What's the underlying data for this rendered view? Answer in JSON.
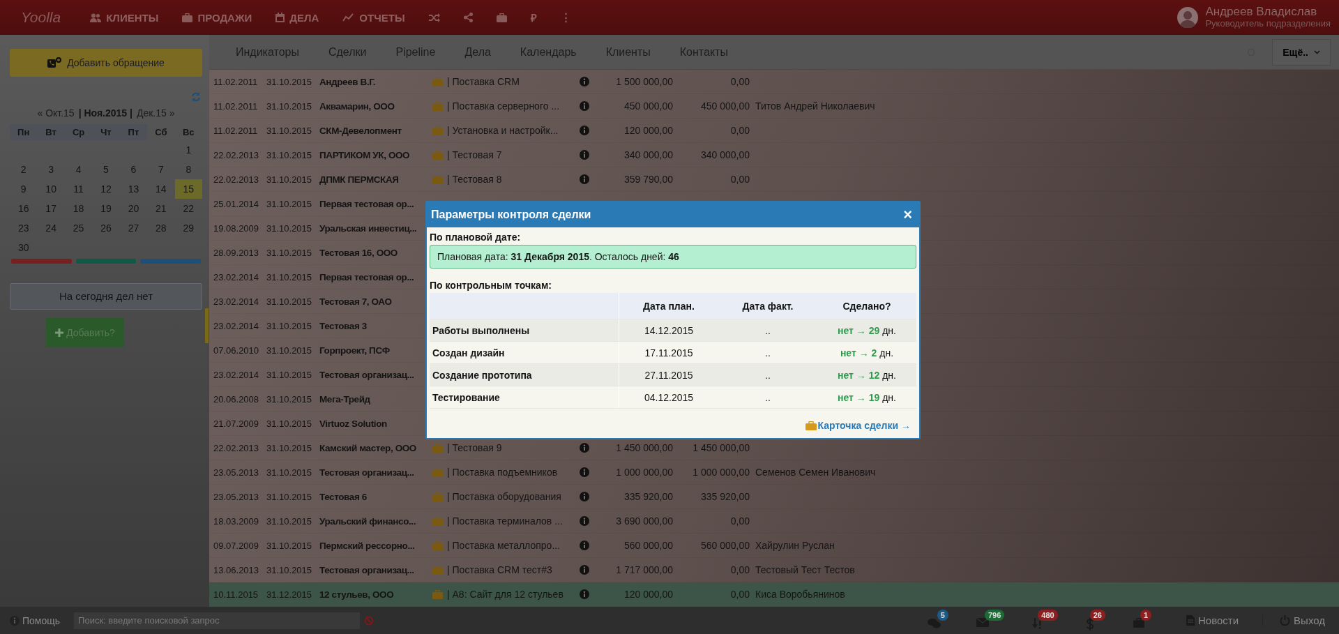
{
  "topbar": {
    "logo": "Yoolla",
    "nav": [
      {
        "kind": "users",
        "label": "КЛИЕНТЫ"
      },
      {
        "kind": "briefcase",
        "label": "ПРОДАЖИ"
      },
      {
        "kind": "calendar",
        "label": "ДЕЛА"
      },
      {
        "kind": "chart",
        "label": "ОТЧЕТЫ"
      },
      {
        "kind": "shuffle"
      },
      {
        "kind": "share"
      },
      {
        "kind": "suitcase"
      },
      {
        "kind": "glyph",
        "label": "₽"
      },
      {
        "kind": "glyph",
        "label": "⋮"
      }
    ],
    "user": {
      "name": "Андреев Владислав",
      "role": "Руководитель подразделения"
    }
  },
  "sidebar": {
    "add_button": "Добавить обращение",
    "calendar": {
      "prev": "« Окт.15",
      "current": "| **Ноя.2015** |",
      "next": "Дек.15 »",
      "weekdays": [
        "Пн",
        "Вт",
        "Ср",
        "Чт",
        "Пт",
        "Сб",
        "Вс"
      ],
      "weeks": [
        [
          {
            "day": "1",
            "today": false
          }
        ],
        [
          {
            "day": "2",
            "today": false
          },
          {
            "day": "3",
            "today": false
          },
          {
            "day": "4",
            "today": false
          },
          {
            "day": "5",
            "today": false
          },
          {
            "day": "6",
            "today": false
          },
          {
            "day": "7",
            "today": false
          },
          {
            "day": "8",
            "today": false
          }
        ],
        [
          {
            "day": "9",
            "today": false
          },
          {
            "day": "10",
            "today": false
          },
          {
            "day": "11",
            "today": false
          },
          {
            "day": "12",
            "today": false
          },
          {
            "day": "13",
            "today": false
          },
          {
            "day": "14",
            "today": false
          },
          {
            "day": "15",
            "today": true
          }
        ],
        [
          {
            "day": "16",
            "today": false
          },
          {
            "day": "17",
            "today": false
          },
          {
            "day": "18",
            "today": false
          },
          {
            "day": "19",
            "today": false
          },
          {
            "day": "20",
            "today": false
          },
          {
            "day": "21",
            "today": false
          },
          {
            "day": "22",
            "today": false
          }
        ],
        [
          {
            "day": "23",
            "today": false
          },
          {
            "day": "24",
            "today": false
          },
          {
            "day": "25",
            "today": false
          },
          {
            "day": "26",
            "today": false
          },
          {
            "day": "27",
            "today": false
          },
          {
            "day": "28",
            "today": false
          },
          {
            "day": "29",
            "today": false
          }
        ],
        [
          {
            "day": "30",
            "today": false
          }
        ]
      ],
      "legend": [
        {
          "color": "#7a1f1f"
        },
        {
          "color": "#0f5a45"
        },
        {
          "color": "#1d4f78"
        }
      ]
    },
    "today_notice": "На сегодня дел нет",
    "add_task": "Добавить?"
  },
  "tabs": [
    {
      "label": "Индикаторы"
    },
    {
      "label": "Сделки"
    },
    {
      "label": "Pipeline"
    },
    {
      "label": "Дела"
    },
    {
      "label": "Календарь"
    },
    {
      "label": "Клиенты"
    },
    {
      "label": "Контакты"
    }
  ],
  "more_button": "Ещё..",
  "deals": [
    {
      "created": "11.02.2011",
      "due": "31.10.2015",
      "client": "Андреев В.Г.",
      "deal": "| Поставка CRM",
      "amount": "1 500 000,00",
      "paid": "0,00",
      "flagged": false,
      "highlighted": false
    },
    {
      "created": "11.02.2011",
      "due": "31.10.2015",
      "client": "Аквамарин, ООО",
      "deal": "| Поставка серверного ...",
      "amount": "450 000,00",
      "paid": "450 000,00",
      "manager": "Титов Андрей Николаевич",
      "flagged": false,
      "highlighted": false
    },
    {
      "created": "11.02.2011",
      "due": "31.10.2015",
      "client": "СКМ-Девелопмент",
      "deal": "| Установка и настройк...",
      "amount": "120 000,00",
      "paid": "0,00",
      "flagged": false,
      "highlighted": false
    },
    {
      "created": "22.02.2013",
      "due": "31.10.2015",
      "client": "ПАРТИКОМ УК, ООО",
      "deal": "| Тестовая 7",
      "amount": "340 000,00",
      "paid": "340 000,00",
      "flagged": false,
      "highlighted": false
    },
    {
      "created": "22.02.2013",
      "due": "31.10.2015",
      "client": "ДПМК ПЕРМСКАЯ",
      "deal": "| Тестовая 8",
      "amount": "359 790,00",
      "paid": "0,00",
      "flagged": false,
      "highlighted": false
    },
    {
      "created": "25.01.2014",
      "due": "31.10.2015",
      "client": "Первая тестовая ор...",
      "flagged": false,
      "highlighted": false
    },
    {
      "created": "19.08.2009",
      "due": "31.10.2015",
      "client": "Уральская инвестиц...",
      "flagged": false,
      "highlighted": false
    },
    {
      "created": "28.09.2013",
      "due": "31.10.2015",
      "client": "Тестовая 16, ООО",
      "flagged": false,
      "highlighted": false
    },
    {
      "created": "23.02.2014",
      "due": "31.10.2015",
      "client": "Первая тестовая ор...",
      "flagged": false,
      "highlighted": false
    },
    {
      "created": "23.02.2014",
      "due": "31.10.2015",
      "client": "Тестовая 7, ОАО",
      "flagged": false,
      "highlighted": false
    },
    {
      "created": "23.02.2014",
      "due": "31.10.2015",
      "client": "Тестовая 3",
      "flagged": true,
      "highlighted": false
    },
    {
      "created": "07.06.2010",
      "due": "31.10.2015",
      "client": "Горпроект, ПСФ",
      "flagged": false,
      "highlighted": false
    },
    {
      "created": "23.02.2014",
      "due": "31.10.2015",
      "client": "Тестовая организац...",
      "flagged": false,
      "highlighted": false
    },
    {
      "created": "20.06.2008",
      "due": "31.10.2015",
      "client": "Мега-Трейд",
      "flagged": false,
      "highlighted": false
    },
    {
      "created": "21.07.2009",
      "due": "31.10.2015",
      "client": "Virtuoz Solution",
      "flagged": false,
      "highlighted": false
    },
    {
      "created": "22.02.2013",
      "due": "31.10.2015",
      "client": "Камский мастер, ООО",
      "deal": "| Тестовая 9",
      "amount": "1 450 000,00",
      "paid": "1 450 000,00",
      "flagged": false,
      "highlighted": false
    },
    {
      "created": "23.05.2013",
      "due": "31.10.2015",
      "client": "Тестовая организац...",
      "deal": "| Поставка подъемников",
      "amount": "1 000 000,00",
      "paid": "1 000 000,00",
      "manager": "Семенов Семен Иванович",
      "flagged": false,
      "highlighted": false
    },
    {
      "created": "23.05.2013",
      "due": "31.10.2015",
      "client": "Тестовая 6",
      "deal": "| Поставка оборудования",
      "amount": "335 920,00",
      "paid": "335 920,00",
      "flagged": false,
      "highlighted": false
    },
    {
      "created": "18.03.2009",
      "due": "31.10.2015",
      "client": "Уральский финансо...",
      "deal": "| Поставка терминалов ...",
      "amount": "3 690 000,00",
      "paid": "0,00",
      "flagged": false,
      "highlighted": false
    },
    {
      "created": "09.07.2009",
      "due": "31.10.2015",
      "client": "Пермский рессорно...",
      "deal": "| Поставка металлопро...",
      "amount": "560 000,00",
      "paid": "560 000,00",
      "manager": "Хайрулин Руслан",
      "flagged": false,
      "highlighted": false
    },
    {
      "created": "13.06.2013",
      "due": "31.10.2015",
      "client": "Тестовая организац...",
      "deal": "| Поставка CRM тест#3",
      "amount": "1 717 000,00",
      "paid": "0,00",
      "manager": "Тестовый Тест Тестов",
      "flagged": false,
      "highlighted": false
    },
    {
      "created": "10.11.2015",
      "due": "31.12.2015",
      "client": "12 стульев, ООО",
      "deal": "| А8: Сайт для 12 стульев",
      "amount": "120 000,00",
      "paid": "0,00",
      "manager": "Киса Воробьянинов",
      "flagged": false,
      "highlighted": true
    }
  ],
  "modal": {
    "title": "Параметры контроля сделки",
    "close": "×",
    "plan_heading": "По плановой дате:",
    "plan_notice": "Плановая дата: **31 Декабря 2015**. Осталось дней: **46**",
    "points_heading": "По контрольным точкам:",
    "columns": [
      "Дата план.",
      "Дата факт.",
      "Сделано?"
    ],
    "points": [
      {
        "name": "Работы выполнены",
        "plan": "14.12.2015",
        "fact": "..",
        "done": "**нет → 29** дн."
      },
      {
        "name": "Создан дизайн",
        "plan": "17.11.2015",
        "fact": "..",
        "done": "**нет → 2** дн."
      },
      {
        "name": "Создание прототипа",
        "plan": "27.11.2015",
        "fact": "..",
        "done": "**нет → 12** дн."
      },
      {
        "name": "Тестирование",
        "plan": "04.12.2015",
        "fact": "..",
        "done": "**нет → 19** дн."
      }
    ],
    "link": "Карточка сделки →"
  },
  "footer": {
    "help": "Помощь",
    "search": {
      "placeholder": "Поиск: введите поисковой запрос"
    },
    "counters": [
      {
        "kind": "chat",
        "count": "5",
        "color": "#1d5a85"
      },
      {
        "kind": "mail",
        "count": "796",
        "color": "#1b6b35"
      },
      {
        "kind": "alert",
        "count": "480",
        "color": "#8c2020"
      },
      {
        "kind": "dollar",
        "count": "26",
        "color": "#8c2020"
      },
      {
        "kind": "briefcase",
        "count": "1",
        "color": "#8c2020"
      }
    ],
    "news": "Новости",
    "logout": "Выход"
  }
}
